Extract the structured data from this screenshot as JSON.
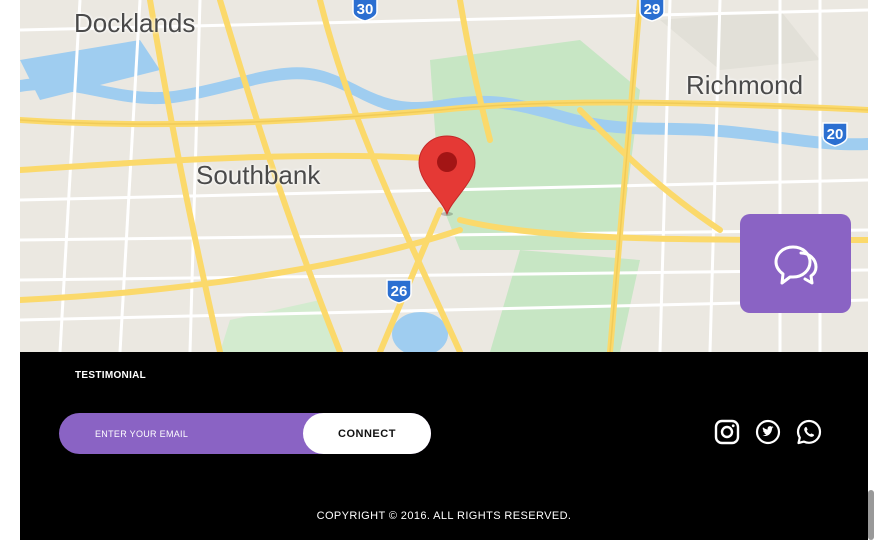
{
  "map": {
    "labels": {
      "docklands": "Docklands",
      "richmond": "Richmond",
      "southbank": "Southbank"
    },
    "route_shields": {
      "r30": "30",
      "r29": "29",
      "r20": "20",
      "r26": "26"
    },
    "colors": {
      "road": "#fbd96b",
      "water": "#9fcdf0",
      "park": "#c7e6c4",
      "land": "#ebe8e1",
      "pin": "#e53935",
      "shield": "#2b6fd1"
    }
  },
  "chat_button": {
    "icon": "chat-bubbles-icon",
    "color": "#8a63c4"
  },
  "footer": {
    "testimonial_label": "TESTIMONIAL",
    "email_placeholder": "ENTER YOUR EMAIL",
    "connect_label": "CONNECT",
    "social_icons": [
      "instagram-icon",
      "twitter-icon",
      "whatsapp-icon"
    ],
    "copyright": "COPYRIGHT © 2016. ALL RIGHTS RESERVED."
  }
}
